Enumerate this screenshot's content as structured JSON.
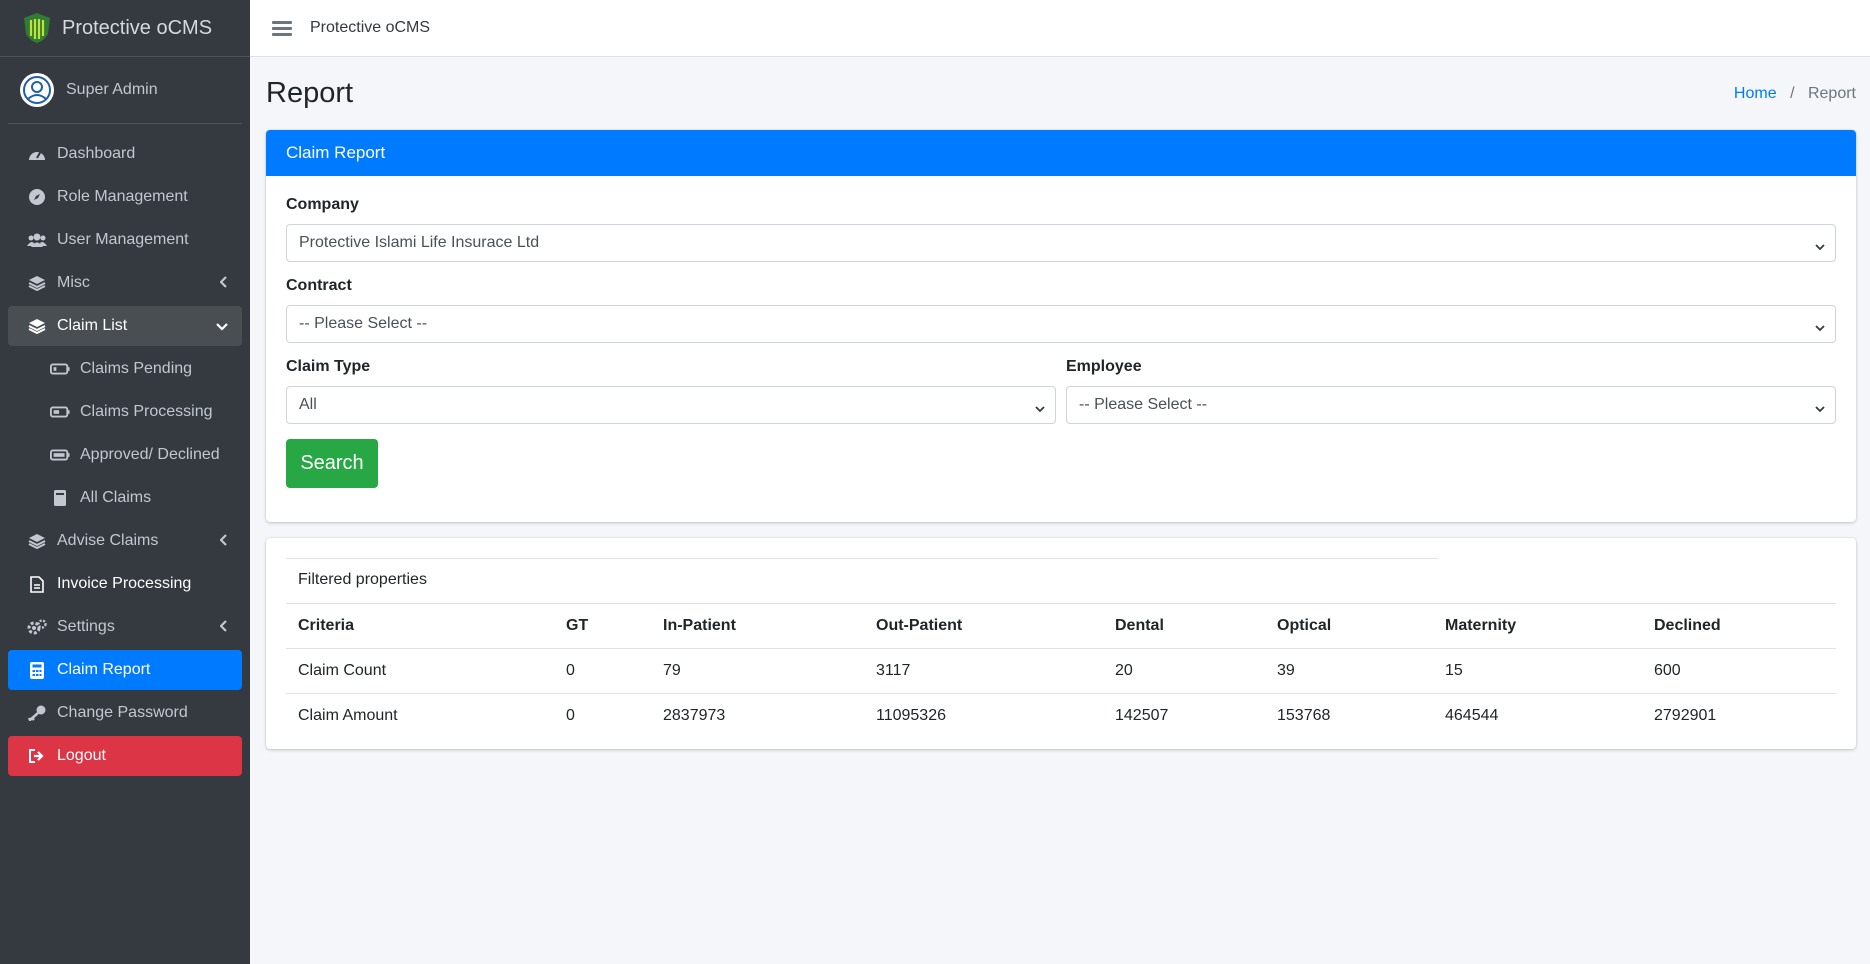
{
  "app": {
    "name": "Protective oCMS"
  },
  "user": {
    "name": "Super Admin"
  },
  "sidebar": {
    "items": [
      {
        "label": "Dashboard"
      },
      {
        "label": "Role Management"
      },
      {
        "label": "User Management"
      },
      {
        "label": "Misc"
      },
      {
        "label": "Claim List"
      },
      {
        "label": "Claims Pending"
      },
      {
        "label": "Claims Processing"
      },
      {
        "label": "Approved/ Declined"
      },
      {
        "label": "All Claims"
      },
      {
        "label": "Advise Claims"
      },
      {
        "label": "Invoice Processing"
      },
      {
        "label": "Settings"
      },
      {
        "label": "Claim Report"
      },
      {
        "label": "Change Password"
      },
      {
        "label": "Logout"
      }
    ]
  },
  "topbar": {
    "title": "Protective oCMS"
  },
  "page": {
    "title": "Report"
  },
  "breadcrumb": {
    "home": "Home",
    "current": "Report"
  },
  "form": {
    "header": "Claim Report",
    "company_label": "Company",
    "company_value": "Protective Islami Life Insurace Ltd",
    "contract_label": "Contract",
    "contract_value": "-- Please Select --",
    "claim_type_label": "Claim Type",
    "claim_type_value": "All",
    "employee_label": "Employee",
    "employee_value": "-- Please Select --",
    "search_label": "Search"
  },
  "results": {
    "caption": "Filtered properties",
    "columns": [
      "Criteria",
      "GT",
      "In-Patient",
      "Out-Patient",
      "Dental",
      "Optical",
      "Maternity",
      "Declined"
    ],
    "rows": [
      [
        "Claim Count",
        "0",
        "79",
        "3117",
        "20",
        "39",
        "15",
        "600"
      ],
      [
        "Claim Amount",
        "0",
        "2837973",
        "11095326",
        "142507",
        "153768",
        "464544",
        "2792901"
      ]
    ]
  },
  "colors": {
    "primary": "#007bff",
    "success": "#28a745",
    "danger": "#dc3545",
    "sidebar": "#343a40"
  }
}
